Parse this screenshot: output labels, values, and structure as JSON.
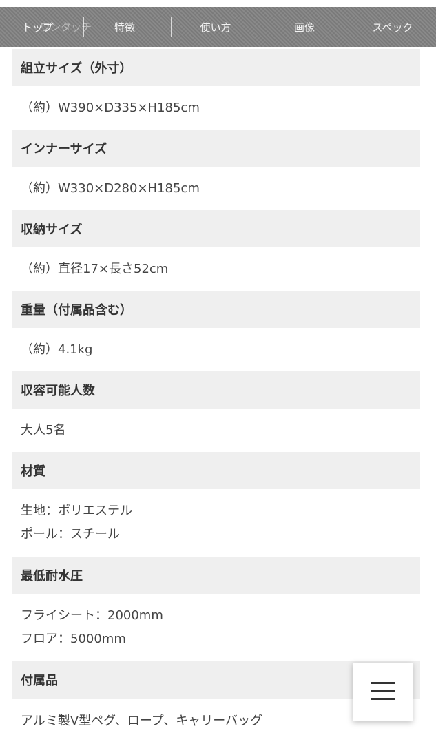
{
  "nav": {
    "items": [
      "トップ",
      "特徴",
      "使い方",
      "画像",
      "スペック"
    ],
    "ghost_text": "ワンタッチ"
  },
  "specs": [
    {
      "label": "組立サイズ（外寸）",
      "values": [
        "（約）W390×D335×H185cm"
      ]
    },
    {
      "label": "インナーサイズ",
      "values": [
        "（約）W330×D280×H185cm"
      ]
    },
    {
      "label": "収納サイズ",
      "values": [
        "（約）直径17×長さ52cm"
      ]
    },
    {
      "label": "重量（付属品含む）",
      "values": [
        "（約）4.1kg"
      ]
    },
    {
      "label": "収容可能人数",
      "values": [
        "大人5名"
      ]
    },
    {
      "label": "材質",
      "values": [
        "生地：ポリエステル",
        "ポール：スチール"
      ]
    },
    {
      "label": "最低耐水圧",
      "values": [
        "フライシート：2000mm",
        "フロア：5000mm"
      ]
    },
    {
      "label": "付属品",
      "values": [
        "アルミ製V型ペグ、ロープ、キャリーバッグ"
      ]
    }
  ],
  "menu_button": {
    "icon": "hamburger-menu-icon"
  }
}
